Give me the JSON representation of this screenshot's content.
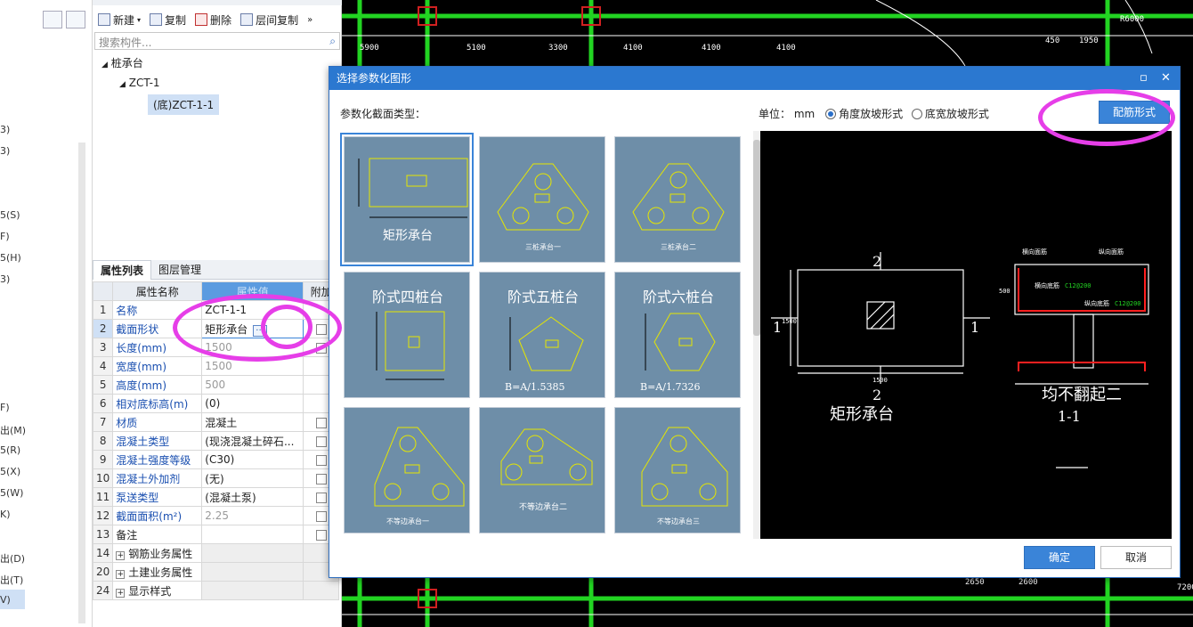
{
  "left_strip": {
    "items": [
      "3)",
      "3)",
      "5(S)",
      "F)",
      "5(H)",
      "3)",
      "F)",
      "出(M)",
      "5(R)",
      "5(X)",
      "5(W)",
      "K)",
      "出(D)",
      "出(T)",
      "V)"
    ]
  },
  "component_panel": {
    "toolbar": {
      "new": "新建",
      "copy": "复制",
      "delete": "删除",
      "floor_copy": "层间复制"
    },
    "search_placeholder": "搜索构件...",
    "tree": {
      "root": "桩承台",
      "child": "ZCT-1",
      "leaf": "(底)ZCT-1-1"
    }
  },
  "property_panel": {
    "tabs": [
      "属性列表",
      "图层管理"
    ],
    "headers": {
      "name": "属性名称",
      "value": "属性值",
      "extra": "附加"
    },
    "rows": [
      {
        "no": "1",
        "name": "名称",
        "value": "ZCT-1-1"
      },
      {
        "no": "2",
        "name": "截面形状",
        "value": "矩形承台"
      },
      {
        "no": "3",
        "name": "长度(mm)",
        "value": "1500"
      },
      {
        "no": "4",
        "name": "宽度(mm)",
        "value": "1500"
      },
      {
        "no": "5",
        "name": "高度(mm)",
        "value": "500"
      },
      {
        "no": "6",
        "name": "相对底标高(m)",
        "value": "(0)"
      },
      {
        "no": "7",
        "name": "材质",
        "value": "混凝土"
      },
      {
        "no": "8",
        "name": "混凝土类型",
        "value": "(现浇混凝土碎石..."
      },
      {
        "no": "9",
        "name": "混凝土强度等级",
        "value": "(C30)"
      },
      {
        "no": "10",
        "name": "混凝土外加剂",
        "value": "(无)"
      },
      {
        "no": "11",
        "name": "泵送类型",
        "value": "(混凝土泵)"
      },
      {
        "no": "12",
        "name": "截面面积(m²)",
        "value": "2.25"
      },
      {
        "no": "13",
        "name": "备注",
        "value": ""
      },
      {
        "no": "14",
        "name": "钢筋业务属性",
        "value": ""
      },
      {
        "no": "20",
        "name": "土建业务属性",
        "value": ""
      },
      {
        "no": "24",
        "name": "显示样式",
        "value": ""
      }
    ]
  },
  "dialog": {
    "title": "选择参数化图形",
    "type_label": "参数化截面类型：",
    "unit_label": "单位：",
    "unit_value": "mm",
    "radio_angle": "角度放坡形式",
    "radio_width": "底宽放坡形式",
    "rebar_button": "配筋形式",
    "ok": "确定",
    "cancel": "取消",
    "tiles": [
      {
        "caption": "矩形承台"
      },
      {
        "caption": "三桩承台一"
      },
      {
        "caption": "三桩承台二"
      },
      {
        "caption": "阶式四桩台"
      },
      {
        "caption": "阶式五桩台",
        "formula": "B=A/1.5385"
      },
      {
        "caption": "阶式六桩台",
        "formula": "B=A/1.7326"
      },
      {
        "caption": "不等边承台一"
      },
      {
        "caption": "不等边承台二"
      },
      {
        "caption": "不等边承台三"
      }
    ],
    "preview": {
      "plan_caption": "矩形承台",
      "section_caption": "均不翻起二",
      "section_id": "1-1",
      "dim_1500": "1500",
      "mark_1": "1",
      "mark_2": "2",
      "rebar_labels": [
        "横向面筋",
        "纵向面筋",
        "横向底筋",
        "纵向底筋"
      ],
      "rebar_values": [
        "C12@200",
        "C12@200"
      ],
      "dim_500": "500"
    }
  },
  "cad_dims": [
    "5900",
    "5100",
    "3300",
    "4100",
    "4100",
    "4100",
    "450",
    "1950",
    "2650",
    "2600",
    "7200",
    "R6000"
  ],
  "colors": {
    "accent": "#2b78d0",
    "annotation_ring": "#e63ee8",
    "cad_green": "#22d422",
    "tile_bg": "#6e8ea8",
    "tile_line": "#e6e600"
  }
}
